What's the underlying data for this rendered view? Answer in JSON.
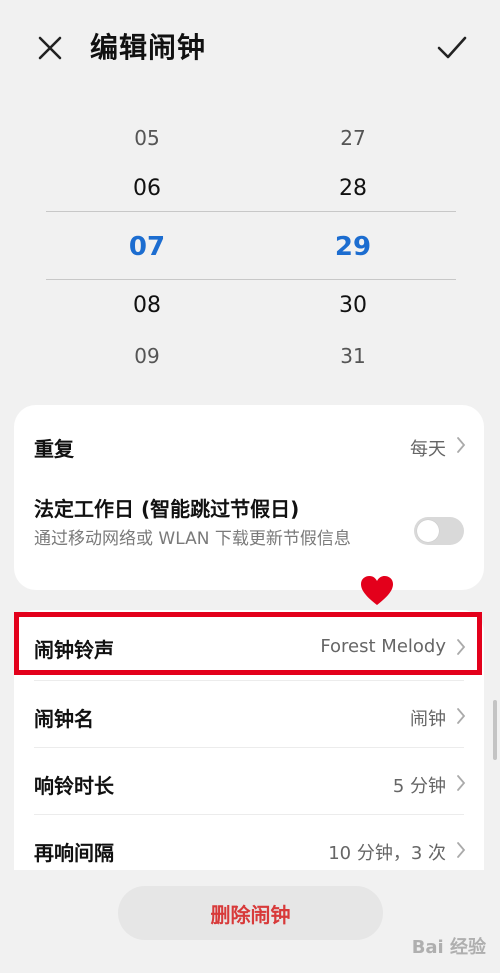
{
  "header": {
    "title": "编辑闹钟",
    "close_icon": "close-icon",
    "confirm_icon": "check-icon"
  },
  "time_picker": {
    "hours": [
      "05",
      "06",
      "07",
      "08",
      "09"
    ],
    "minutes": [
      "27",
      "28",
      "29",
      "30",
      "31"
    ],
    "selected_hour": "07",
    "selected_minute": "29",
    "selected_color": "#1c6dd0"
  },
  "settings": {
    "repeat": {
      "label": "重复",
      "value": "每天"
    },
    "workday": {
      "label": "法定工作日 (智能跳过节假日)",
      "description": "通过移动网络或 WLAN 下载更新节假信息",
      "enabled": false
    },
    "ringtone": {
      "label": "闹钟铃声",
      "value": "Forest Melody"
    },
    "alarm_name": {
      "label": "闹钟名",
      "value": "闹钟"
    },
    "ring_duration": {
      "label": "响铃时长",
      "value": "5 分钟"
    },
    "snooze": {
      "label": "再响间隔",
      "value": "10 分钟，3 次"
    }
  },
  "delete_button": {
    "label": "删除闹钟",
    "color": "#d83a3a"
  },
  "annotation": {
    "highlight_color": "#e3001b",
    "marker_icon": "heart-icon"
  },
  "watermark": {
    "text": "Bai 经验"
  }
}
